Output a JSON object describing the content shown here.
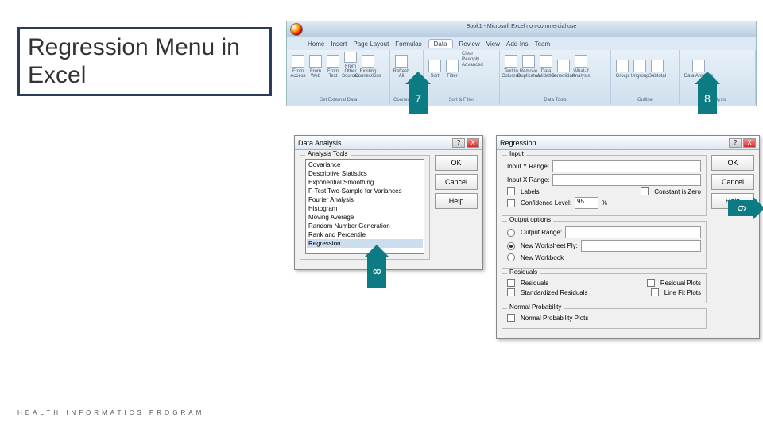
{
  "slide": {
    "title": "Regression Menu in Excel",
    "footer": "HEALTH INFORMATICS PROGRAM"
  },
  "callouts": {
    "c7": "7",
    "c8top": "8",
    "c8": "8",
    "c9": "9"
  },
  "ribbon": {
    "window_title": "Book1 - Microsoft Excel non-commercial use",
    "tabs": [
      "Home",
      "Insert",
      "Page Layout",
      "Formulas",
      "Data",
      "Review",
      "View",
      "Add-Ins",
      "Team"
    ],
    "active_tab": "Data",
    "groups": {
      "get_external": {
        "label": "Get External Data",
        "items": [
          "From Access",
          "From Web",
          "From Text",
          "From Other Sources",
          "Existing Connections"
        ]
      },
      "connections": {
        "label": "Connections",
        "items": [
          "Refresh All"
        ]
      },
      "sortfilter": {
        "label": "Sort & Filter",
        "items": [
          "Sort",
          "Filter",
          "Clear",
          "Reapply",
          "Advanced"
        ]
      },
      "datatools": {
        "label": "Data Tools",
        "items": [
          "Text to Columns",
          "Remove Duplicates",
          "Data Validation",
          "Consolidate",
          "What-If Analysis"
        ]
      },
      "outline": {
        "label": "Outline",
        "items": [
          "Group",
          "Ungroup",
          "Subtotal"
        ]
      },
      "analysis": {
        "label": "Analysis",
        "items": [
          "Data Analysis"
        ]
      }
    }
  },
  "data_analysis_dialog": {
    "title": "Data Analysis",
    "group_label": "Analysis Tools",
    "tools": [
      "Covariance",
      "Descriptive Statistics",
      "Exponential Smoothing",
      "F-Test Two-Sample for Variances",
      "Fourier Analysis",
      "Histogram",
      "Moving Average",
      "Random Number Generation",
      "Rank and Percentile",
      "Regression"
    ],
    "selected": "Regression",
    "ok": "OK",
    "cancel": "Cancel",
    "help": "Help"
  },
  "regression_dialog": {
    "title": "Regression",
    "ok": "OK",
    "cancel": "Cancel",
    "help": "Help",
    "input": {
      "legend": "Input",
      "y_label": "Input Y Range:",
      "x_label": "Input X Range:",
      "labels": "Labels",
      "const_zero": "Constant is Zero",
      "conf": "Confidence Level:",
      "conf_val": "95",
      "pct": "%"
    },
    "output": {
      "legend": "Output options",
      "range": "Output Range:",
      "ws": "New Worksheet Ply:",
      "wb": "New Workbook"
    },
    "residuals": {
      "legend": "Residuals",
      "res": "Residuals",
      "stdres": "Standardized Residuals",
      "resplots": "Residual Plots",
      "lineplots": "Line Fit Plots"
    },
    "normal": {
      "legend": "Normal Probability",
      "npp": "Normal Probability Plots"
    }
  }
}
